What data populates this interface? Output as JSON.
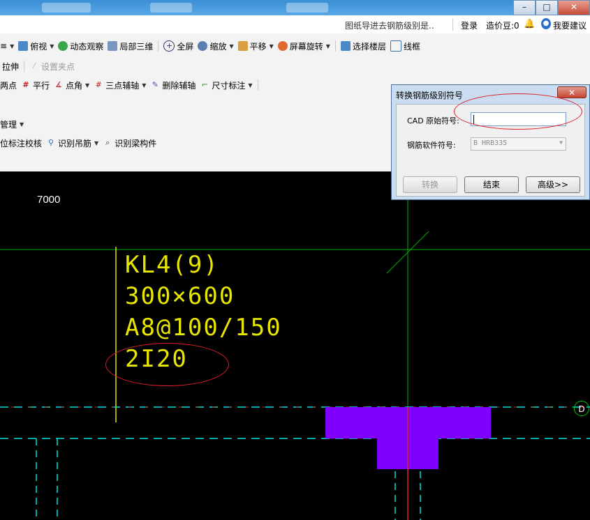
{
  "window": {
    "minimize_label": "–",
    "restore_label": "□",
    "close_label": "✕"
  },
  "infobar": {
    "notice": "图纸导进去钢筋级别是..",
    "login": "登录",
    "beans": "造价豆:0",
    "suggest": "我要建议"
  },
  "toolbar_row1": {
    "partial": "≡",
    "top_view": "俯视",
    "dynamic_view": "动态观察",
    "local_3d": "局部三维",
    "fullscreen": "全屏",
    "zoom": "缩放",
    "pan": "平移",
    "screen_rotate": "屏幕旋转",
    "select_floor": "选择楼层",
    "wireframe": "线框"
  },
  "toolbar_row2": {
    "stretch": "拉伸",
    "set_grip": "设置夹点"
  },
  "toolbar_row3": {
    "partial_point": "两点",
    "parallel": "平行",
    "point_angle": "点角",
    "three_point_axis": "三点辅轴",
    "delete_axis": "删除辅轴",
    "dimension": "尺寸标注"
  },
  "toolbar_row4": {
    "manage": "管理"
  },
  "toolbar_row5": {
    "check_annotation": "位标注校核",
    "identify_hanger": "识别吊筋",
    "identify_beam": "识别梁构件"
  },
  "canvas": {
    "dimension_value": "7000",
    "beam_lines": [
      "KL4(9)",
      "300×600",
      "A8@100/150",
      "2I20"
    ],
    "axis_label": "D",
    "colors": {
      "text": "#e6e600",
      "axis": "#00c800",
      "axis_dash": "#00e0e0",
      "red_line": "#e0202a",
      "column": "#8000ff"
    }
  },
  "dialog": {
    "title": "转换钢筋级别符号",
    "close_label": "✕",
    "cad_symbol_label": "CAD 原始符号:",
    "cad_symbol_value": "",
    "software_symbol_label": "钢筋软件符号:",
    "software_symbol_value": "B HRB335",
    "convert_button": "转换",
    "finish_button": "结束",
    "advanced_button": "高级>>"
  }
}
